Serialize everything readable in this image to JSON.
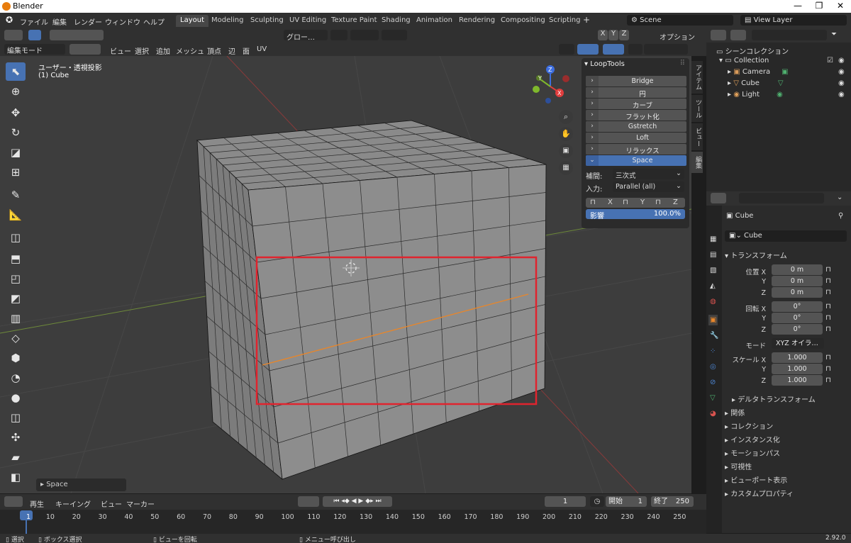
{
  "window": {
    "title": "Blender"
  },
  "menu": [
    "ファイル",
    "編集",
    "レンダー",
    "ウィンドウ",
    "ヘルプ"
  ],
  "workspaces": [
    "Layout",
    "Modeling",
    "Sculpting",
    "UV Editing",
    "Texture Paint",
    "Shading",
    "Animation",
    "Rendering",
    "Compositing",
    "Scripting"
  ],
  "scene": "Scene",
  "view_layer": "View Layer",
  "header": {
    "transform_orientation": "グロー…",
    "options_label": "オプション",
    "axes": [
      "X",
      "Y",
      "Z"
    ]
  },
  "viewport_header": {
    "mode": "編集モード",
    "menus": [
      "ビュー",
      "選択",
      "追加",
      "メッシュ",
      "頂点",
      "辺",
      "面",
      "UV"
    ]
  },
  "viewport": {
    "overlay_line1": "ユーザー・透視投影",
    "overlay_line2": "(1) Cube",
    "gizmo": {
      "x": "X",
      "y": "Y",
      "z": "Z"
    },
    "last_op": "Space"
  },
  "loop_tools": {
    "title": "LoopTools",
    "items": [
      "Bridge",
      "円",
      "カーブ",
      "フラット化",
      "Gstretch",
      "Loft",
      "リラックス",
      "Space"
    ],
    "interp_label": "補間:",
    "interp_value": "三次式",
    "input_label": "入力:",
    "input_value": "Parallel (all)",
    "lock_axes": [
      "X",
      "Y",
      "Z"
    ],
    "influence_label": "影響",
    "influence_value": "100.0%"
  },
  "side_tabs": [
    "アイテム",
    "ツール",
    "ビュー",
    "編集"
  ],
  "outliner": {
    "scene_collection": "シーンコレクション",
    "collection": "Collection",
    "items": [
      "Camera",
      "Cube",
      "Light"
    ]
  },
  "properties": {
    "object_name": "Cube",
    "data_name": "Cube",
    "transform_header": "トランスフォーム",
    "location": {
      "label_x": "位置 X",
      "x": "0 m",
      "y": "0 m",
      "z": "0 m"
    },
    "rotation": {
      "label_x": "回転 X",
      "x": "0°",
      "y": "0°",
      "z": "0°"
    },
    "mode_label": "モード",
    "mode_value": "XYZ オイラ…",
    "scale": {
      "label_x": "スケール X",
      "x": "1.000",
      "y": "1.000",
      "z": "1.000"
    },
    "axis_y": "Y",
    "axis_z": "Z",
    "delta": "デルタトランスフォーム",
    "sections": [
      "関係",
      "コレクション",
      "インスタンス化",
      "モーションパス",
      "可視性",
      "ビューポート表示",
      "カスタムプロパティ"
    ]
  },
  "timeline": {
    "menus": [
      "再生",
      "キーイング",
      "ビュー",
      "マーカー"
    ],
    "current_frame": "1",
    "start_label": "開始",
    "start": "1",
    "end_label": "終了",
    "end": "250",
    "ticks": [
      "1",
      "10",
      "20",
      "30",
      "40",
      "50",
      "60",
      "70",
      "80",
      "90",
      "100",
      "110",
      "120",
      "130",
      "140",
      "150",
      "160",
      "170",
      "180",
      "190",
      "200",
      "210",
      "220",
      "230",
      "240",
      "250"
    ]
  },
  "statusbar": {
    "select": "選択",
    "box_select": "ボックス選択",
    "rotate": "ビューを回転",
    "menu": "メニュー呼び出し",
    "version": "2.92.0"
  },
  "colors": {
    "accent": "#4772b3",
    "highlight_box": "#e0242e",
    "edge_selected": "#e8862a"
  }
}
